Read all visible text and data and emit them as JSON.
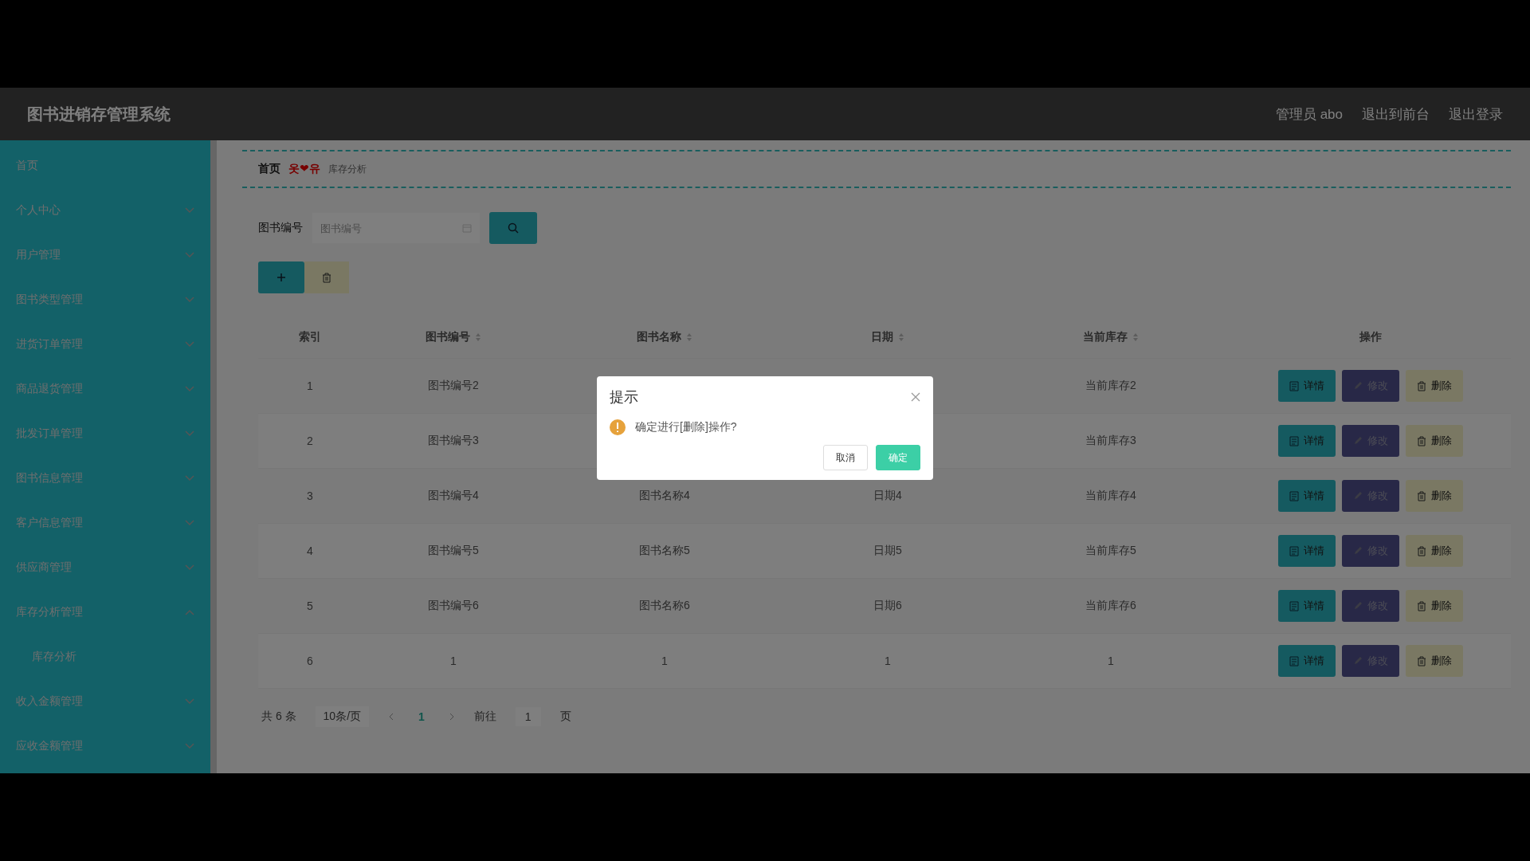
{
  "header": {
    "title": "图书进销存管理系统",
    "links": [
      "管理员 abo",
      "退出到前台",
      "退出登录"
    ]
  },
  "sidebar": {
    "items": [
      {
        "label": "首页",
        "kind": "link"
      },
      {
        "label": "个人中心",
        "kind": "menu",
        "expanded": false
      },
      {
        "label": "用户管理",
        "kind": "menu",
        "expanded": false
      },
      {
        "label": "图书类型管理",
        "kind": "menu",
        "expanded": false
      },
      {
        "label": "进货订单管理",
        "kind": "menu",
        "expanded": false
      },
      {
        "label": "商品退货管理",
        "kind": "menu",
        "expanded": false
      },
      {
        "label": "批发订单管理",
        "kind": "menu",
        "expanded": false
      },
      {
        "label": "图书信息管理",
        "kind": "menu",
        "expanded": false
      },
      {
        "label": "客户信息管理",
        "kind": "menu",
        "expanded": false
      },
      {
        "label": "供应商管理",
        "kind": "menu",
        "expanded": false
      },
      {
        "label": "库存分析管理",
        "kind": "menu",
        "expanded": true,
        "children": [
          {
            "label": "库存分析"
          }
        ]
      },
      {
        "label": "收入金额管理",
        "kind": "menu",
        "expanded": false
      },
      {
        "label": "应收金额管理",
        "kind": "menu",
        "expanded": false
      }
    ]
  },
  "breadcrumb": {
    "home": "首页",
    "separator": "옷❤유",
    "current": "库存分析"
  },
  "search": {
    "label": "图书编号",
    "placeholder": "图书编号"
  },
  "table": {
    "columns": [
      {
        "label": "索引",
        "sortable": false
      },
      {
        "label": "图书编号",
        "sortable": true
      },
      {
        "label": "图书名称",
        "sortable": true
      },
      {
        "label": "日期",
        "sortable": true
      },
      {
        "label": "当前库存",
        "sortable": true
      },
      {
        "label": "操作",
        "sortable": false
      }
    ],
    "rows": [
      {
        "index": "1",
        "code": "图书编号2",
        "stock": "当前库存2",
        "actions": [
          "详情",
          "修改",
          "删除"
        ]
      },
      {
        "index": "2",
        "code": "图书编号3",
        "stock": "当前库存3",
        "actions": [
          "详情",
          "修改",
          "删除"
        ]
      },
      {
        "index": "3",
        "code": "图书编号4",
        "name": "图书名称4",
        "date": "日期4",
        "stock": "当前库存4",
        "actions": [
          "详情",
          "修改",
          "删除"
        ]
      },
      {
        "index": "4",
        "code": "图书编号5",
        "name": "图书名称5",
        "date": "日期5",
        "stock": "当前库存5",
        "actions": [
          "详情",
          "修改",
          "删除"
        ]
      },
      {
        "index": "5",
        "code": "图书编号6",
        "name": "图书名称6",
        "date": "日期6",
        "stock": "当前库存6",
        "actions": [
          "详情",
          "修改",
          "删除"
        ]
      },
      {
        "index": "6",
        "code": "1",
        "name": "1",
        "date": "1",
        "stock": "1",
        "actions": [
          "详情",
          "修改",
          "删除"
        ]
      }
    ]
  },
  "pagination": {
    "total": "共 6 条",
    "page_size": "10条/页",
    "pages": [
      {
        "label": "1",
        "selected": true
      }
    ],
    "goto_label": "前往",
    "goto_value": "1",
    "goto_suffix": "页"
  },
  "dialog": {
    "title": "提示",
    "message": "确定进行[删除]操作?",
    "buttons": [
      {
        "label": "取消",
        "kind": "default"
      },
      {
        "label": "确定",
        "kind": "primary"
      }
    ]
  }
}
